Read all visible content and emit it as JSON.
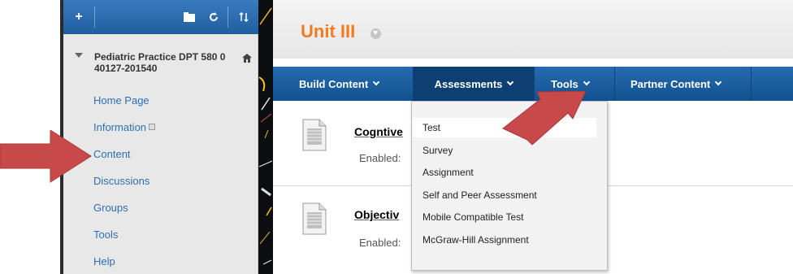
{
  "sidebar": {
    "toolbar": {
      "add_label": "+",
      "folder_icon": "folder-icon",
      "refresh_icon": "refresh-icon",
      "sort_icon": "sort-icon"
    },
    "course_title": "Pediatric Practice DPT 580 0 40127-201540",
    "items": [
      {
        "label": "Home Page"
      },
      {
        "label": "Information"
      },
      {
        "label": "Content"
      },
      {
        "label": "Discussions"
      },
      {
        "label": "Groups"
      },
      {
        "label": "Tools"
      },
      {
        "label": "Help"
      }
    ]
  },
  "header": {
    "title": "Unit III"
  },
  "action_bar": {
    "items": [
      {
        "label": "Build Content"
      },
      {
        "label": "Assessments"
      },
      {
        "label": "Tools"
      },
      {
        "label": "Partner Content"
      }
    ]
  },
  "content": {
    "items": [
      {
        "title": "Cogntive",
        "meta": "Enabled:"
      },
      {
        "title": "Objectiv",
        "meta": "Enabled:"
      }
    ]
  },
  "assessments_menu": {
    "items": [
      {
        "label": "Test"
      },
      {
        "label": "Survey"
      },
      {
        "label": "Assignment"
      },
      {
        "label": "Self and Peer Assessment"
      },
      {
        "label": "Mobile Compatible Test"
      },
      {
        "label": "McGraw-Hill Assignment"
      }
    ]
  },
  "colors": {
    "accent_orange": "#f07b20",
    "nav_blue": "#2e6fb0",
    "action_bar_blue": "#1a5c9e",
    "annotation_red": "#c8494a"
  }
}
